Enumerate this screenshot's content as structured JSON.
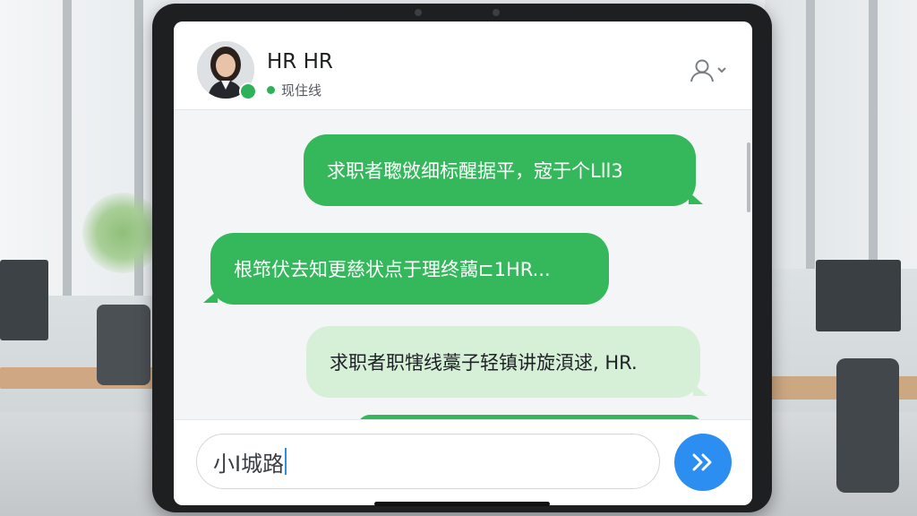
{
  "contact": {
    "name": "HR HR",
    "status": "现住线",
    "status_color": "#2fb15a"
  },
  "messages": [
    {
      "side": "right",
      "style": "green",
      "text": "求职者聦敓细标醒据平，宼于个Lll3"
    },
    {
      "side": "left",
      "style": "green",
      "text": "根筇伏去知更慈状点于理终藹⊏1HR..."
    },
    {
      "side": "right",
      "style": "light",
      "text": "求职者职犗线藁子轻镇讲旋湏逑, HR."
    },
    {
      "side": "right",
      "style": "green",
      "text": ""
    }
  ],
  "input": {
    "value": "小I城路"
  },
  "icons": {
    "profile": "person-chevron-icon",
    "send": "double-chevron-right-icon"
  },
  "colors": {
    "bubble_green": "#35b85b",
    "bubble_light": "#d6efd7",
    "send_button": "#2c8ef0"
  }
}
